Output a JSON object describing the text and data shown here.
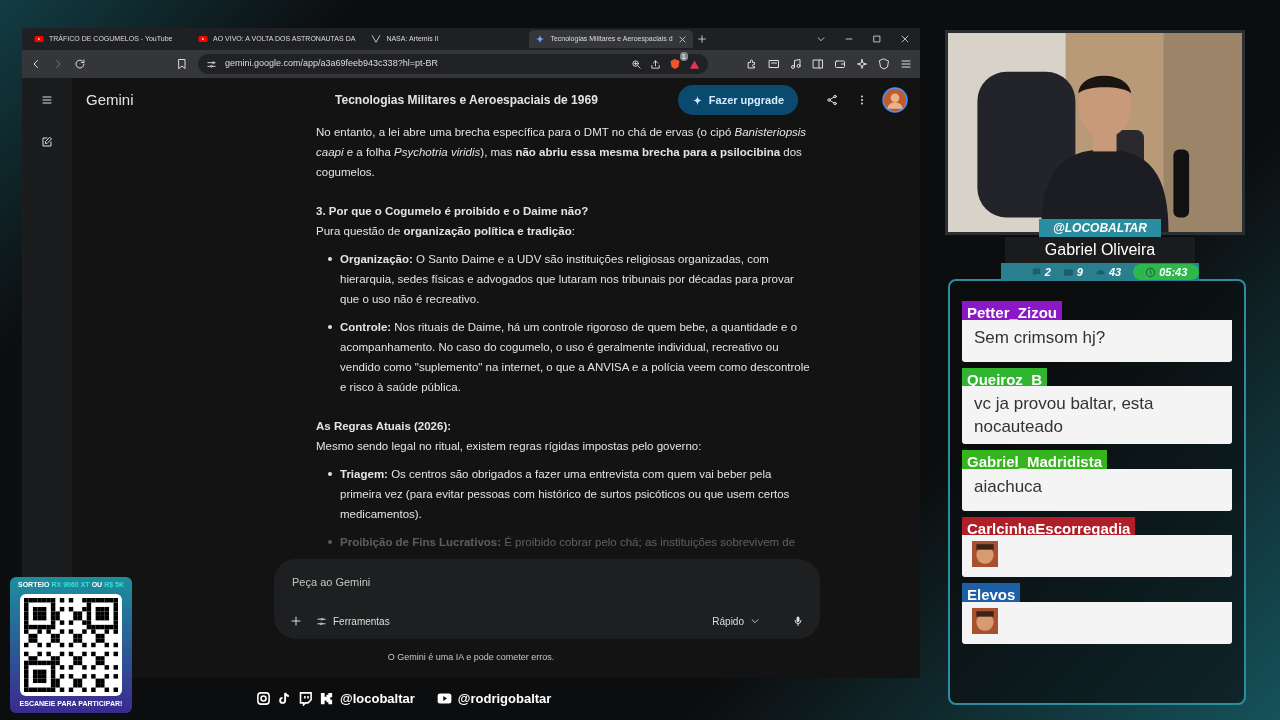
{
  "browser": {
    "tabs": [
      {
        "label": "TRÁFICO DE COGUMELOS - YouTube",
        "kind": "youtube",
        "selected": false
      },
      {
        "label": "AO VIVO: A VOLTA DOS ASTRONAUTAS DA",
        "kind": "youtube",
        "selected": false
      },
      {
        "label": "NASA: Artemis II",
        "kind": "site",
        "selected": false
      },
      {
        "label": "Tecnologias Militares e Aeroespaciais d",
        "kind": "gemini",
        "selected": true
      }
    ],
    "address": "gemini.google.com/app/a3a69feeb943c338?hl=pt-BR",
    "shield_count": "1"
  },
  "gemini": {
    "brand": "Gemini",
    "title": "Tecnologias Militares e Aeroespaciais de 1969",
    "upgrade": "Fazer upgrade",
    "content": [
      {
        "kind": "paragraph",
        "text": "No entanto, a lei abre uma brecha específica para o DMT no chá de ervas (o cipó *Banisteriopsis caapi* e a folha *Psychotria viridis*), mas **não abriu essa mesma brecha para a psilocibina** dos cogumelos."
      },
      {
        "kind": "heading",
        "text": "3. Por que o Cogumelo é proibido e o Daime não?"
      },
      {
        "kind": "paragraph",
        "text": "Pura questão de **organização política e tradição**:"
      },
      {
        "kind": "bullet",
        "text": "**Organização:** O Santo Daime e a UDV são instituições religiosas organizadas, com hierarquia, sedes físicas e advogados que lutaram nos tribunais por décadas para provar que o uso não é recreativo."
      },
      {
        "kind": "bullet",
        "text": "**Controle:** Nos rituais de Daime, há um controle rigoroso de quem bebe, a quantidade e o acompanhamento. No caso do cogumelo, o uso é geralmente individual, recreativo ou vendido como \"suplemento\" na internet, o que a ANVISA e a polícia veem como descontrole e risco à saúde pública."
      },
      {
        "kind": "heading",
        "text": "As Regras Atuais (2026):"
      },
      {
        "kind": "paragraph",
        "text": "Mesmo sendo legal no ritual, existem regras rígidas impostas pelo governo:"
      },
      {
        "kind": "bullet",
        "text": "**Triagem:** Os centros são obrigados a fazer uma entrevista com quem vai beber pela primeira vez (para evitar pessoas com histórico de surtos psicóticos ou que usem certos medicamentos)."
      },
      {
        "kind": "bullet",
        "faded": true,
        "text": "**Proibição de Fins Lucrativos:** É proibido cobrar pelo chá; as instituições sobrevivem de"
      }
    ],
    "input": {
      "placeholder": "Peça ao Gemini"
    },
    "tools": "Ferramentas",
    "mode": "Rápido",
    "disclaimer": "O Gemini é uma IA e pode cometer erros."
  },
  "streamer": {
    "handle": "@LOCOBALTAR",
    "name": "Gabriel Oliveira",
    "stats": [
      {
        "kind": "chat",
        "value": "2"
      },
      {
        "kind": "video",
        "value": "9"
      },
      {
        "kind": "gauge",
        "value": "43"
      },
      {
        "kind": "clock",
        "value": "05:43"
      }
    ]
  },
  "chat": [
    {
      "user": "Petter_Zizou",
      "color": "#8a18c4",
      "kind": "text",
      "message": "Sem crimsom hj?"
    },
    {
      "user": "Queiroz_B",
      "color": "#2fb52f",
      "kind": "text",
      "message": "vc ja provou baltar, esta nocauteado"
    },
    {
      "user": "Gabriel_Madridista",
      "color": "#34b51e",
      "kind": "text",
      "message": "aiachuca"
    },
    {
      "user": "CarlcinhaEscorregadia",
      "color": "#b01e2a",
      "kind": "emote"
    },
    {
      "user": "Elevos",
      "color": "#1d5fa6",
      "kind": "emote"
    }
  ],
  "giveaway": {
    "title": [
      {
        "text": "SORTEIO",
        "highlight": false
      },
      {
        "text": "RX 9060 XT",
        "highlight": true
      },
      {
        "text": "OU",
        "highlight": false
      },
      {
        "text": "R$ 5K",
        "highlight": true
      }
    ],
    "footer": "ESCANEIE PARA PARTICIPAR!"
  },
  "socials": [
    {
      "kind": "instagram"
    },
    {
      "kind": "tiktok"
    },
    {
      "kind": "twitch"
    },
    {
      "kind": "kick"
    },
    {
      "kind": "handle",
      "text": "@locobaltar"
    },
    {
      "kind": "youtube"
    },
    {
      "kind": "handle",
      "text": "@rodrigobaltar"
    }
  ]
}
